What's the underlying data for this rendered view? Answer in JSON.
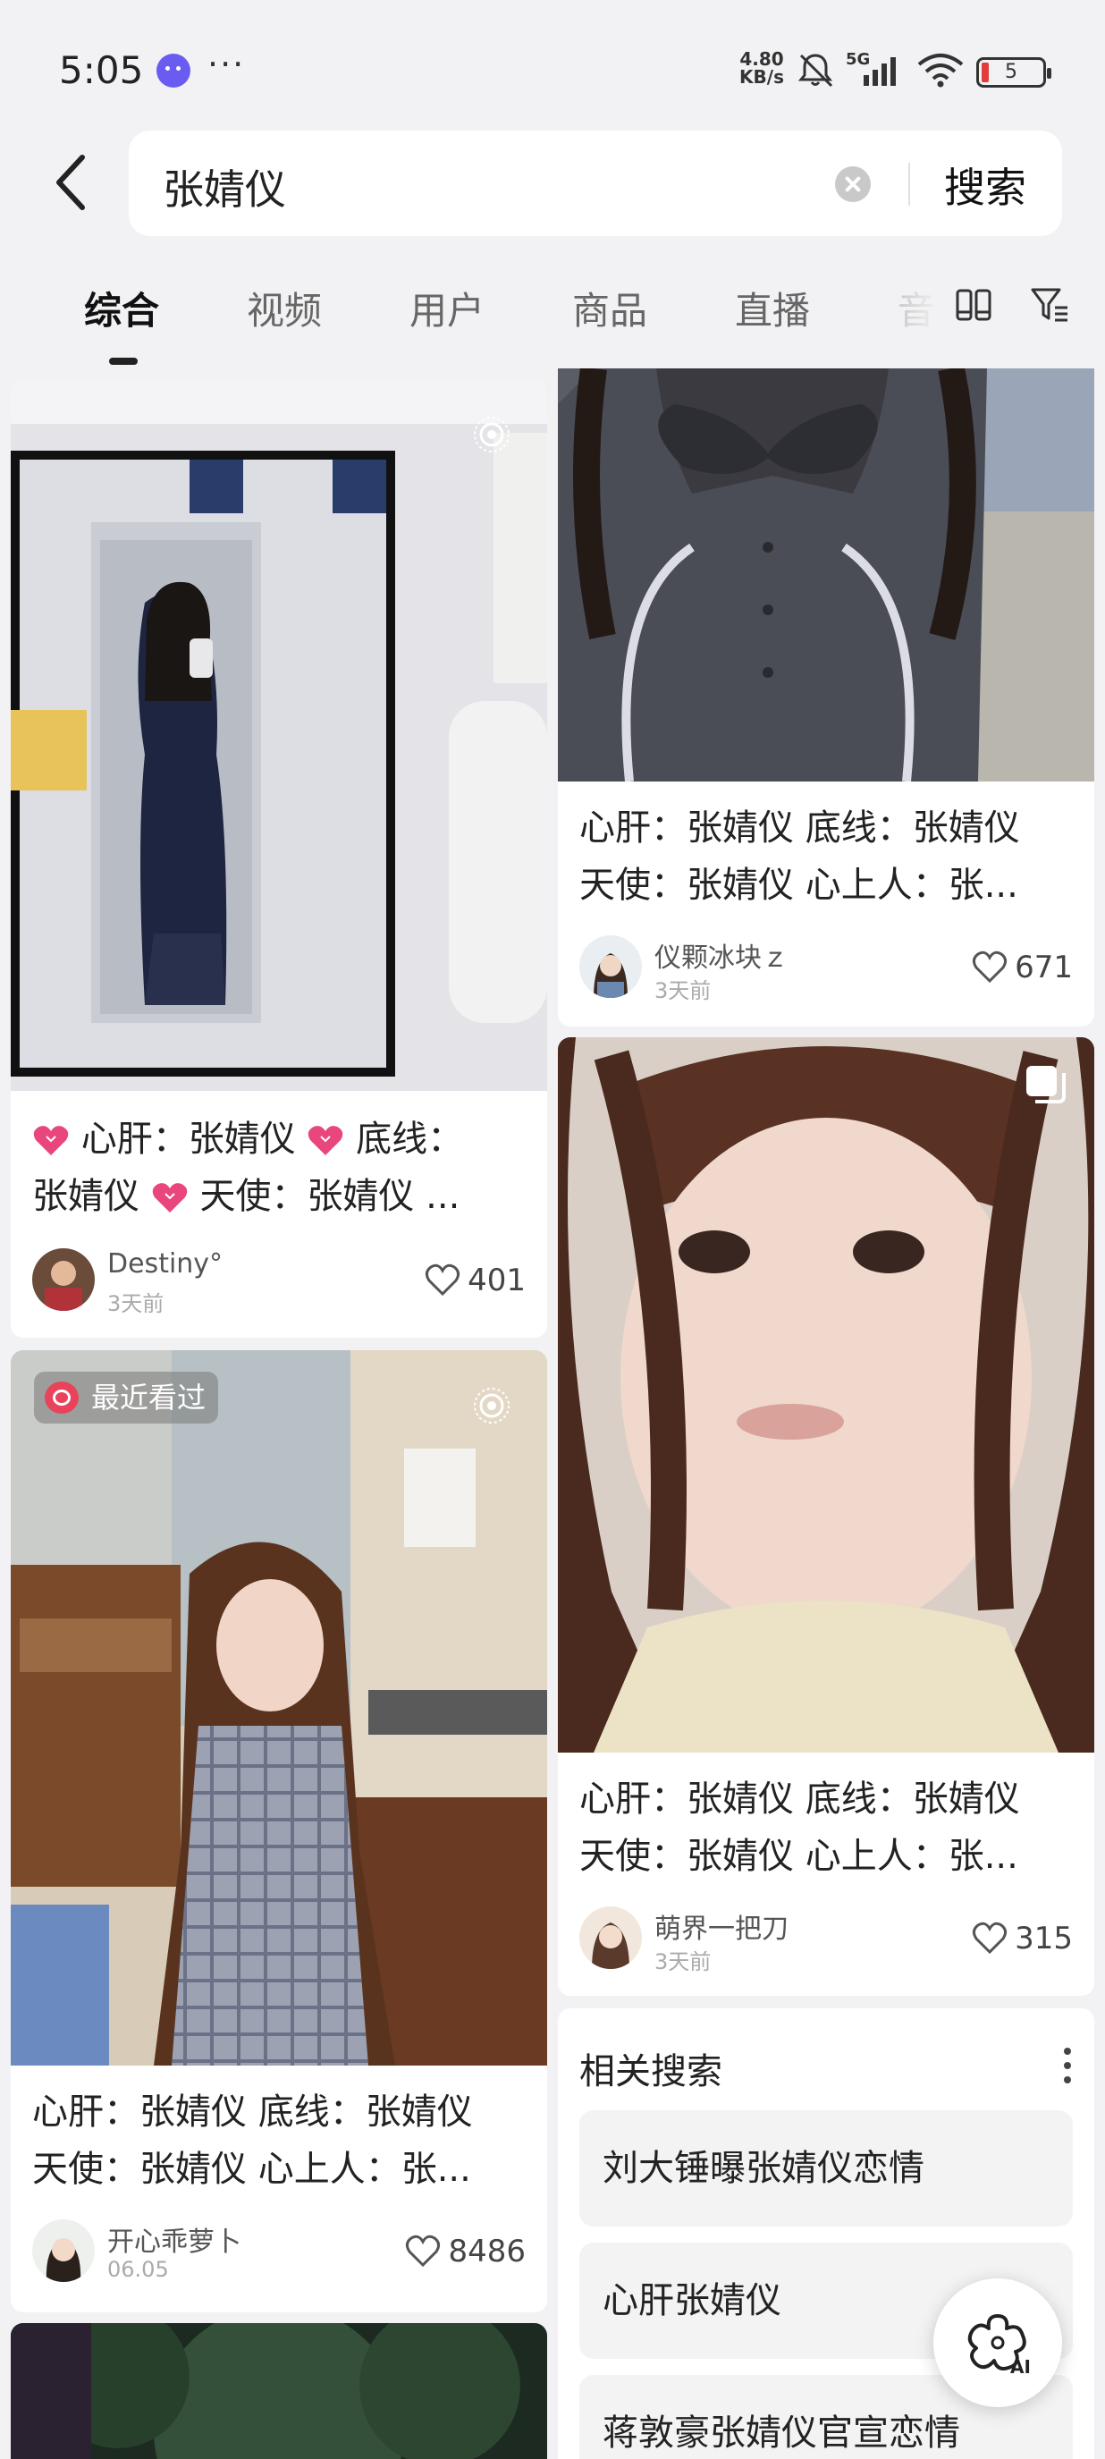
{
  "status_bar": {
    "time": "5:05",
    "more": "···",
    "net_speed_value": "4.80",
    "net_speed_unit": "KB/s",
    "signal": "5G",
    "battery_level": "5"
  },
  "search": {
    "query": "张婧仪",
    "button_label": "搜索"
  },
  "tabs": [
    {
      "label": "综合",
      "active": true
    },
    {
      "label": "视频",
      "active": false
    },
    {
      "label": "用户",
      "active": false
    },
    {
      "label": "商品",
      "active": false
    },
    {
      "label": "直播",
      "active": false
    },
    {
      "label": "音",
      "active": false
    }
  ],
  "cards": {
    "left": [
      {
        "caption_line1": "心肝：张婧仪",
        "caption_line1b": "底线：",
        "caption_line2a": "张婧仪",
        "caption_line2b": "天使：张婧仪 ...",
        "author": "Destiny°",
        "time": "3天前",
        "likes": "401"
      },
      {
        "badge": "最近看过",
        "caption_line1": "心肝：张婧仪 底线：张婧仪",
        "caption_line2": "天使：张婧仪 心上人：张...",
        "author": "开心乖萝卜",
        "time": "06.05",
        "likes": "8486"
      }
    ],
    "right": [
      {
        "caption_line1": "心肝：张婧仪 底线：张婧仪",
        "caption_line2": "天使：张婧仪 心上人：张...",
        "author": "仪颗冰块ｚ",
        "time": "3天前",
        "likes": "671"
      },
      {
        "caption_line1": "心肝：张婧仪 底线：张婧仪",
        "caption_line2": "天使：张婧仪 心上人：张...",
        "author": "萌界一把刀",
        "time": "3天前",
        "likes": "315"
      }
    ]
  },
  "related": {
    "title": "相关搜索",
    "items": [
      "刘大锤曝张婧仪恋情",
      "心肝张婧仪",
      "蒋敦豪张婧仪官宣恋情"
    ]
  },
  "ai_fab_label": "AI",
  "colors": {
    "background": "#f2f2f4",
    "heart_emoji": "#e8467c",
    "battery_low": "#e23b3b"
  }
}
